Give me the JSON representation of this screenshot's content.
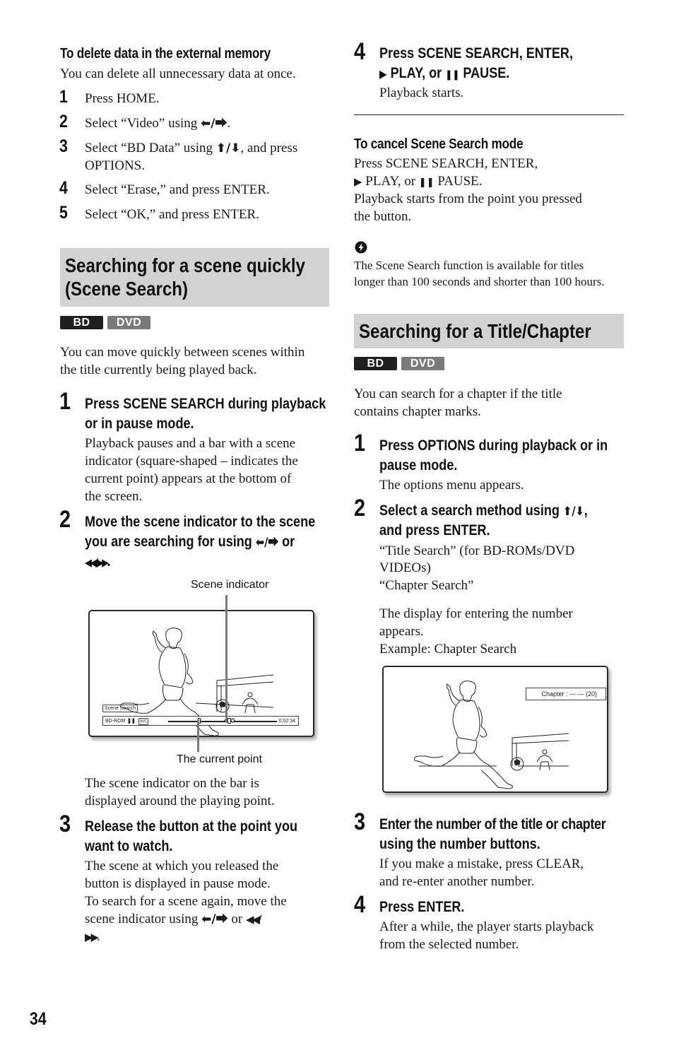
{
  "page_number": "34",
  "left": {
    "delete_heading": "To delete data in the external memory",
    "delete_intro": "You can delete all unnecessary data at once.",
    "delete_steps": [
      {
        "num": "1",
        "pre": "Press HOME.",
        "arrows": "",
        "post": ""
      },
      {
        "num": "2",
        "pre": "Select “Video” using ",
        "arrows": "⬅/⮕",
        "post": "."
      },
      {
        "num": "3",
        "pre": "Select “BD Data” using ",
        "arrows": "⬆/⬇",
        "post": ", and press"
      },
      {
        "num": "4",
        "pre": "Select “Erase,” and press ENTER.",
        "arrows": "",
        "post": ""
      },
      {
        "num": "5",
        "pre": "Select “OK,” and press ENTER.",
        "arrows": "",
        "post": ""
      }
    ],
    "delete_step3_line2": "OPTIONS.",
    "scene_section_title_line1": "Searching for a scene quickly",
    "scene_section_title_line2": "(Scene Search)",
    "badges": {
      "bd": "BD",
      "dvd": "DVD"
    },
    "scene_intro_line1": "You can move quickly between scenes within",
    "scene_intro_line2": "the title currently being played back.",
    "step1": {
      "num": "1",
      "title_line1": "Press SCENE SEARCH during playback",
      "title_line2": "or in pause mode.",
      "body": [
        "Playback pauses and a bar with a scene",
        "indicator (square-shaped – indicates the",
        "current point) appears at the bottom of",
        "the screen."
      ]
    },
    "step2": {
      "num": "2",
      "title_line1": "Move the scene indicator to the scene",
      "title_line2_pre": "you are searching for using ",
      "title_line2_arrows": "⬅/⮕",
      "title_line2_post": " or",
      "title_line3_symbols": "◀◀/▶▶",
      "title_line3_post": "."
    },
    "figure1": {
      "label_top": "Scene indicator",
      "label_bottom": "The current point",
      "osd_tag": "Scene Search",
      "osd_disc": "BD-ROM",
      "osd_pause": "❚❚",
      "osd_audio": "AVC",
      "osd_time": "0:02:34"
    },
    "fig1_note_line1": "The scene indicator on the bar is",
    "fig1_note_line2": "displayed around the playing point.",
    "step3": {
      "num": "3",
      "title_line1": "Release the button at the point you",
      "title_line2": "want to watch.",
      "body_line1": "The scene at which you released the",
      "body_line2": "button is displayed in pause mode.",
      "body_line3": "To search for a scene again, move the",
      "body_line4_pre": "scene indicator using ",
      "body_line4_arrows": "⬅/⮕",
      "body_line4_mid": " or ",
      "body_line4_sym": "◀◀/",
      "body_line5_sym": "▶▶",
      "body_line5_post": "."
    }
  },
  "right": {
    "step4": {
      "num": "4",
      "title_line1": "Press SCENE SEARCH, ENTER,",
      "title_line2_play_sym": "▶",
      "title_line2_mid": " PLAY, or ",
      "title_line2_pause_sym": "❚❚",
      "title_line2_post": " PAUSE.",
      "body": "Playback starts."
    },
    "cancel_heading": "To cancel Scene Search mode",
    "cancel_line1": "Press SCENE SEARCH, ENTER,",
    "cancel_line2_play": "▶",
    "cancel_line2_mid": " PLAY, or ",
    "cancel_line2_pause": "❚❚",
    "cancel_line2_post": " PAUSE.",
    "cancel_line3": "Playback starts from the point you pressed",
    "cancel_line4": "the button.",
    "hint_line1": "The Scene Search function is available for titles",
    "hint_line2": "longer than 100 seconds and shorter than 100 hours.",
    "title_section_title": "Searching for a Title/Chapter",
    "badges": {
      "bd": "BD",
      "dvd": "DVD"
    },
    "title_intro_line1": "You can search for a chapter if the title",
    "title_intro_line2": "contains chapter marks.",
    "tstep1": {
      "num": "1",
      "title_line1": "Press OPTIONS during playback or in",
      "title_line2": "pause mode.",
      "body": "The options menu appears."
    },
    "tstep2": {
      "num": "2",
      "title_line1_pre": "Select a search method using ",
      "title_line1_arrows": "⬆/⬇",
      "title_line1_post": ",",
      "title_line2": "and press ENTER.",
      "opt1_line1": "“Title Search” (for BD-ROMs/DVD",
      "opt1_line2": "VIDEOs)",
      "opt2": "“Chapter Search”",
      "display_line1": "The display for entering the number",
      "display_line2": "appears.",
      "example": "Example: Chapter Search"
    },
    "figure2": {
      "chapter_label": "Chapter :  — — (20)"
    },
    "tstep3": {
      "num": "3",
      "title_line1": "Enter the number of the title or chapter",
      "title_line2": "using the number buttons.",
      "body_line1": "If you make a mistake, press CLEAR,",
      "body_line2": "and re-enter another number."
    },
    "tstep4": {
      "num": "4",
      "title": "Press ENTER.",
      "body_line1": "After a while, the player starts playback",
      "body_line2": "from the selected number."
    }
  }
}
